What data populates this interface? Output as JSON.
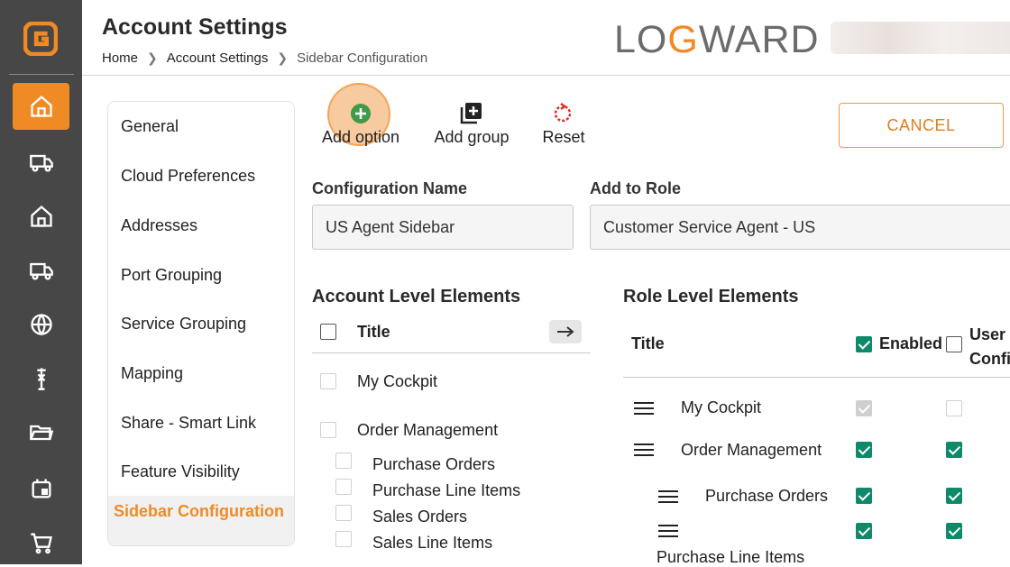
{
  "header": {
    "title": "Account Settings",
    "breadcrumb": [
      "Home",
      "Account Settings",
      "Sidebar Configuration"
    ],
    "brand": {
      "pre": "LO",
      "accent": "G",
      "post": "WARD"
    }
  },
  "settings_nav": {
    "items": [
      "General",
      "Cloud Preferences",
      "Addresses",
      "Port Grouping",
      "Service Grouping",
      "Mapping",
      "Share - Smart Link",
      "Feature Visibility"
    ],
    "active": "Sidebar Configuration"
  },
  "toolbar": {
    "add_option": "Add option",
    "add_group": "Add group",
    "reset": "Reset",
    "cancel": "CANCEL"
  },
  "form": {
    "config_name_label": "Configuration Name",
    "config_name_value": "US Agent Sidebar",
    "role_label": "Add to Role",
    "role_value": "Customer Service Agent - US"
  },
  "account_level": {
    "title": "Account Level Elements",
    "column": "Title",
    "items": [
      {
        "label": "My Cockpit"
      },
      {
        "label": "Order Management"
      },
      {
        "label": "Purchase Orders"
      },
      {
        "label": "Purchase Line Items"
      },
      {
        "label": "Sales Orders"
      },
      {
        "label": "Sales Line Items"
      }
    ]
  },
  "role_level": {
    "title": "Role Level Elements",
    "col_title": "Title",
    "col_enabled": "Enabled",
    "col_user_config": "User Confi",
    "rows": [
      {
        "label": "My Cockpit",
        "enabled": true,
        "user_config": false
      },
      {
        "label": "Order Management",
        "enabled": true,
        "user_config": true
      },
      {
        "label": "Purchase Orders",
        "enabled": true,
        "user_config": true
      },
      {
        "label": "Purchase Line Items",
        "enabled": true,
        "user_config": true
      }
    ]
  },
  "colors": {
    "accent": "#f08a24",
    "check": "#0e8a6a",
    "rail": "#474747"
  }
}
